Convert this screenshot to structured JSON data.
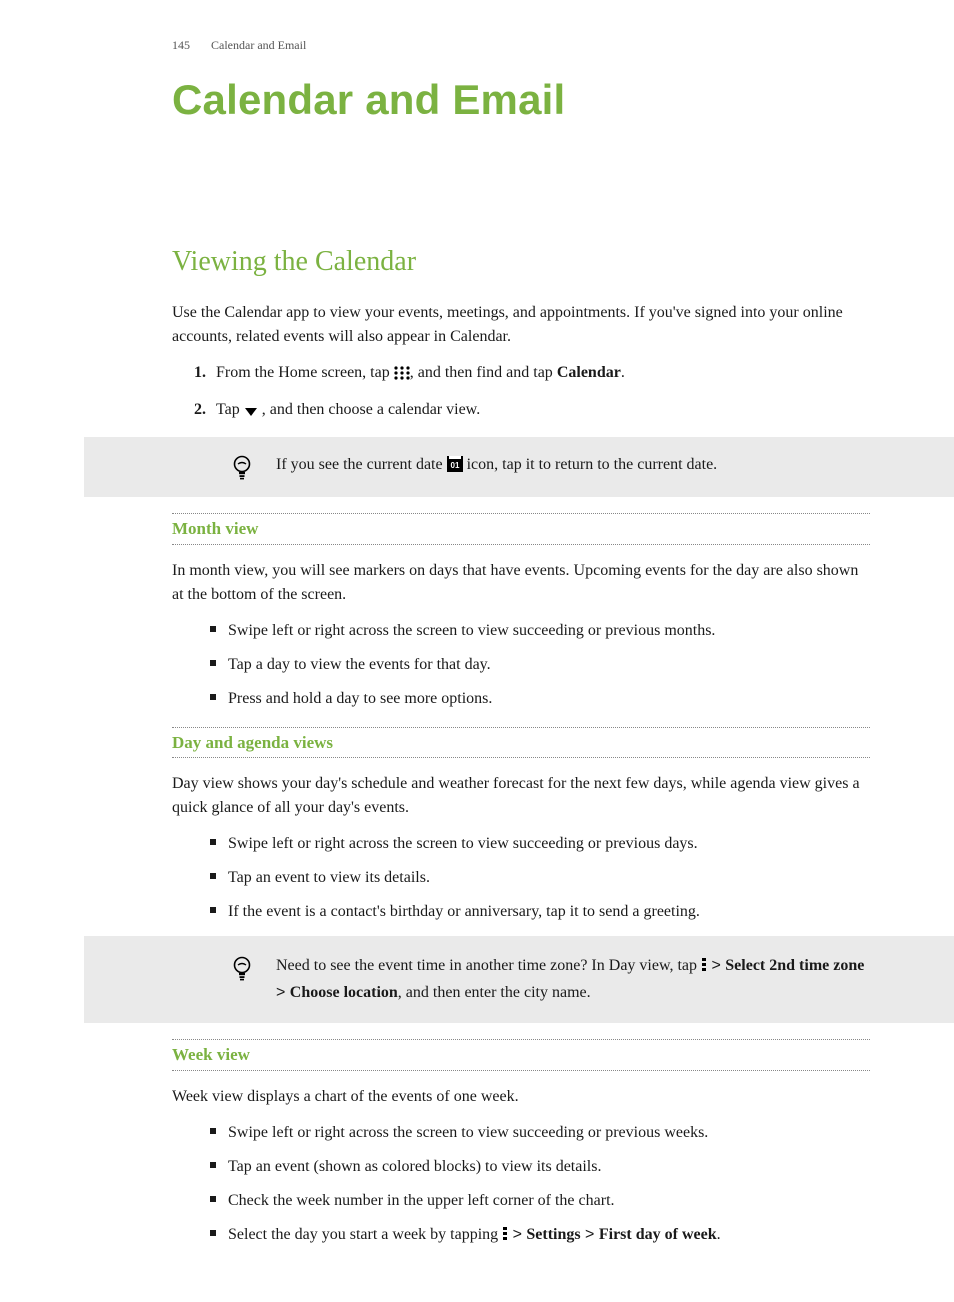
{
  "header": {
    "page_number": "145",
    "running_title": "Calendar and Email"
  },
  "title": "Calendar and Email",
  "section_heading": "Viewing the Calendar",
  "intro": "Use the Calendar app to view your events, meetings, and appointments. If you've signed into your online accounts, related events will also appear in Calendar.",
  "steps": {
    "s1_a": "From the Home screen, tap ",
    "s1_b": ", and then find and tap ",
    "s1_bold": "Calendar",
    "s1_c": ".",
    "s2_a": "Tap ",
    "s2_b": " , and then choose a calendar view."
  },
  "tip1": {
    "a": "If you see the current date ",
    "b": " icon, tap it to return to the current date."
  },
  "month": {
    "heading": "Month view",
    "para": "In month view, you will see markers on days that have events. Upcoming events for the day are also shown at the bottom of the screen.",
    "b1": "Swipe left or right across the screen to view succeeding or previous months.",
    "b2": "Tap a day to view the events for that day.",
    "b3": "Press and hold a day to see more options."
  },
  "day": {
    "heading": "Day and agenda views",
    "para": "Day view shows your day's schedule and weather forecast for the next few days, while agenda view gives a quick glance of all your day's events.",
    "b1": "Swipe left or right across the screen to view succeeding or previous days.",
    "b2": "Tap an event to view its details.",
    "b3": "If the event is a contact's birthday or anniversary, tap it to send a greeting."
  },
  "tip2": {
    "a": "Need to see the event time in another time zone? In Day view, tap ",
    "sep": " > ",
    "bold1": "Select 2nd time zone",
    "bold2": "Choose location",
    "b": ", and then enter the city name."
  },
  "week": {
    "heading": "Week view",
    "para": "Week view displays a chart of the events of one week.",
    "b1": "Swipe left or right across the screen to view succeeding or previous weeks.",
    "b2": "Tap an event (shown as colored blocks) to view its details.",
    "b3": "Check the week number in the upper left corner of the chart.",
    "b4_a": "Select the day you start a week by tapping ",
    "b4_sep": " > ",
    "b4_bold1": "Settings",
    "b4_bold2": "First day of week",
    "b4_end": "."
  },
  "icons": {
    "apps_grid": "apps-grid-icon",
    "dropdown": "dropdown-triangle-icon",
    "date_tile": "current-date-icon",
    "bulb": "tip-bulb-icon",
    "overflow": "overflow-menu-icon"
  }
}
